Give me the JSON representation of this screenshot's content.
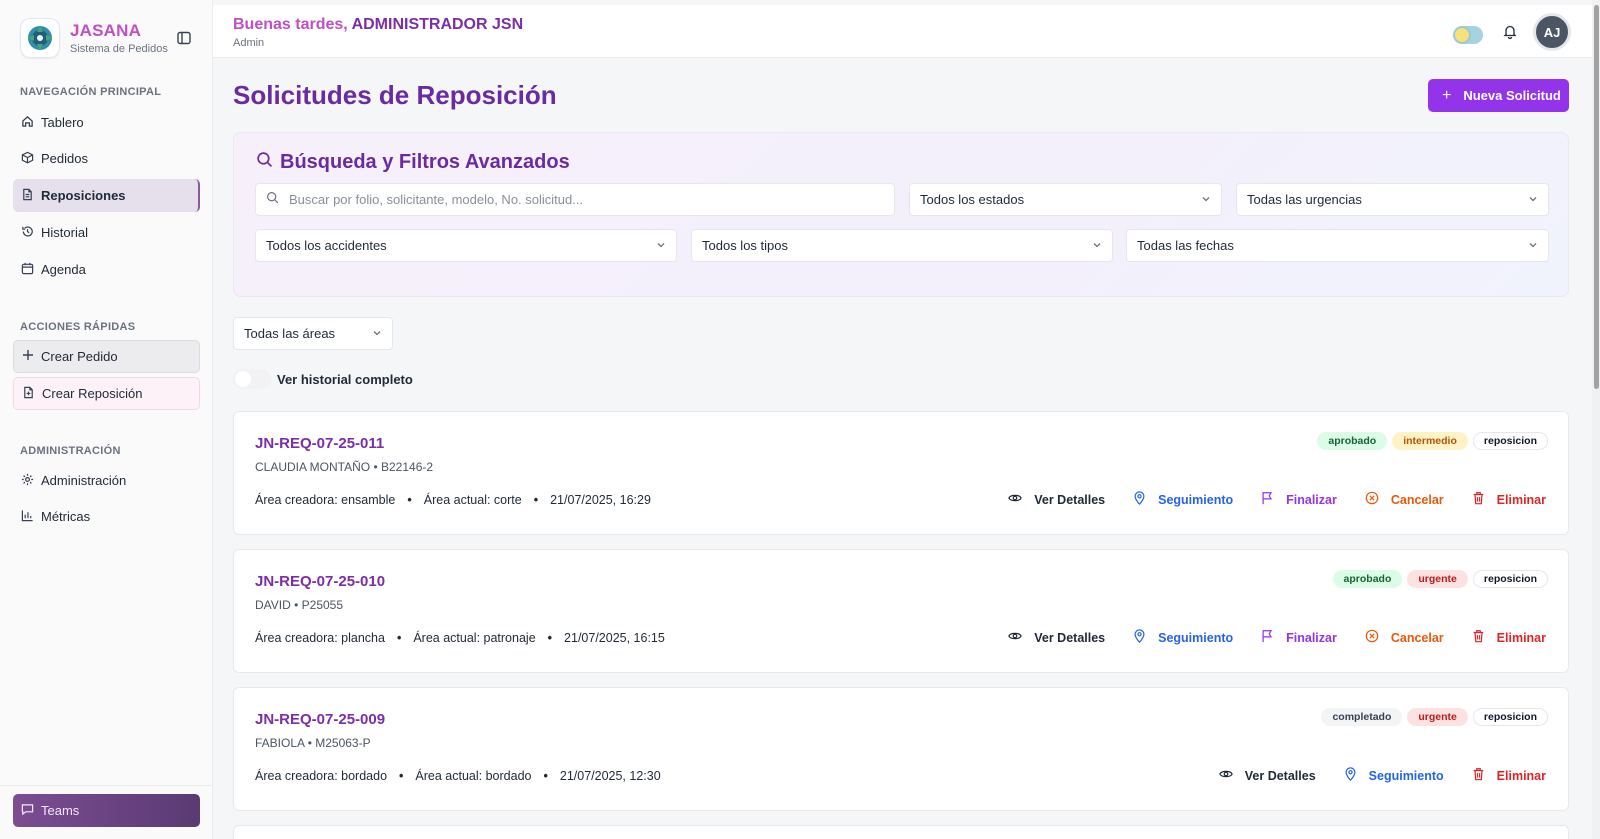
{
  "brand": {
    "name": "JASANA",
    "subtitle": "Sistema de Pedidos"
  },
  "sidebar": {
    "nav_title": "NAVEGACIÓN PRINCIPAL",
    "nav_items": [
      {
        "label": "Tablero",
        "icon": "home-icon"
      },
      {
        "label": "Pedidos",
        "icon": "package-icon"
      },
      {
        "label": "Reposiciones",
        "icon": "file-icon",
        "active": true
      },
      {
        "label": "Historial",
        "icon": "history-icon"
      },
      {
        "label": "Agenda",
        "icon": "calendar-icon"
      }
    ],
    "quick_title": "ACCIONES RÁPIDAS",
    "quick_items": [
      {
        "label": "Crear Pedido",
        "icon": "plus-icon"
      },
      {
        "label": "Crear Reposición",
        "icon": "file-plus-icon"
      }
    ],
    "admin_title": "ADMINISTRACIÓN",
    "admin_items": [
      {
        "label": "Administración",
        "icon": "gear-icon"
      },
      {
        "label": "Métricas",
        "icon": "bar-chart-icon"
      }
    ],
    "teams_label": "Teams"
  },
  "header": {
    "greeting_prefix": "Buenas tardes, ",
    "user_name": "ADMINISTRADOR JSN",
    "role": "Admin",
    "avatar_initials": "AJ"
  },
  "main": {
    "title": "Solicitudes de Reposición",
    "new_button": "Nueva Solicitud",
    "filters": {
      "title": "Búsqueda y Filtros Avanzados",
      "search_placeholder": "Buscar por folio, solicitante, modelo, No. solicitud...",
      "status": "Todos los estados",
      "urgency": "Todas las urgencias",
      "accidents": "Todos los accidentes",
      "types": "Todos los tipos",
      "dates": "Todas las fechas"
    },
    "area_filter": "Todas las áreas",
    "history_toggle": "Ver historial completo"
  },
  "requests": [
    {
      "folio": "JN-REQ-07-25-011",
      "sub": "CLAUDIA MONTAÑO • B22146-2",
      "creator_area": "Área creadora: ensamble",
      "current_area": "Área actual: corte",
      "datetime": "21/07/2025, 16:29",
      "badges": [
        {
          "text": "aprobado",
          "style": "green"
        },
        {
          "text": "intermedio",
          "style": "yellow"
        },
        {
          "text": "reposicion",
          "style": "white"
        }
      ]
    },
    {
      "folio": "JN-REQ-07-25-010",
      "sub": "DAVID • P25055",
      "creator_area": "Área creadora: plancha",
      "current_area": "Área actual: patronaje",
      "datetime": "21/07/2025, 16:15",
      "badges": [
        {
          "text": "aprobado",
          "style": "green"
        },
        {
          "text": "urgente",
          "style": "red"
        },
        {
          "text": "reposicion",
          "style": "white"
        }
      ]
    },
    {
      "folio": "JN-REQ-07-25-009",
      "sub": "FABIOLA • M25063-P",
      "creator_area": "Área creadora: bordado",
      "current_area": "Área actual: bordado",
      "datetime": "21/07/2025, 12:30",
      "badges": [
        {
          "text": "completado",
          "style": "gray"
        },
        {
          "text": "urgente",
          "style": "red"
        },
        {
          "text": "reposicion",
          "style": "white"
        }
      ]
    }
  ],
  "actions": {
    "view": "Ver Detalles",
    "track": "Seguimiento",
    "finish": "Finalizar",
    "cancel": "Cancelar",
    "delete": "Eliminar"
  },
  "colors": {
    "brand_pink": "#c04ec7",
    "title_purple": "#6a2ba0",
    "primary_button": "#9333ea",
    "track_blue": "#2563eb",
    "cancel_orange": "#ea580c",
    "delete_red": "#dc2626"
  }
}
